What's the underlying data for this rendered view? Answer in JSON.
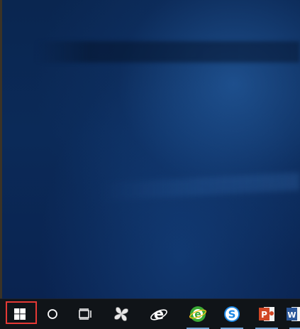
{
  "desktop": {
    "accent_color": "#0b2a58"
  },
  "taskbar": {
    "background": "#101418",
    "highlight_color": "#e53935",
    "items": [
      {
        "icon": "windows-logo-icon",
        "running": false,
        "highlighted": true
      },
      {
        "icon": "search-circle-icon",
        "running": false
      },
      {
        "icon": "task-view-icon",
        "running": false
      },
      {
        "icon": "pinwheel-app-icon",
        "running": false
      },
      {
        "icon": "internet-explorer-icon",
        "running": false
      },
      {
        "icon": "green-browser-icon",
        "running": true
      },
      {
        "icon": "sogou-browser-icon",
        "running": true
      },
      {
        "icon": "powerpoint-icon",
        "running": true
      },
      {
        "icon": "word-icon",
        "running": true
      }
    ]
  }
}
